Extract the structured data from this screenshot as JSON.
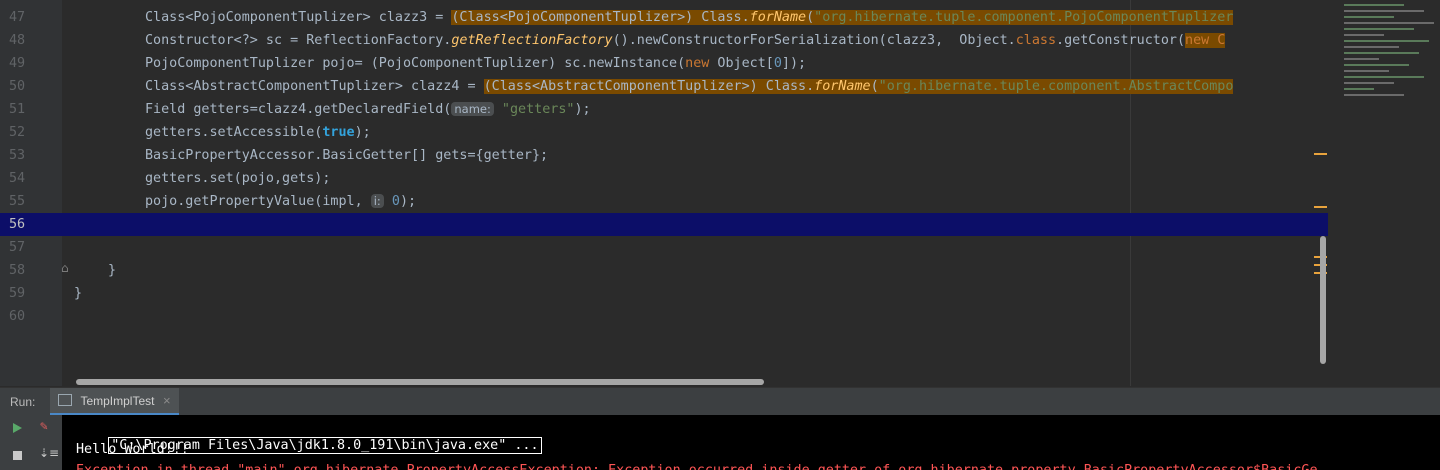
{
  "editor": {
    "lines": [
      {
        "num": "47",
        "segments": [
          {
            "t": "Class<PojoComponentTuplizer> clazz3 = ",
            "c": ""
          },
          {
            "t": "(Class<PojoComponentTuplizer>) Class.",
            "c": "hl"
          },
          {
            "t": "forName",
            "c": "hl it"
          },
          {
            "t": "(",
            "c": "hl"
          },
          {
            "t": "\"org.hibernate.tuple.component.PojoComponentTuplizer",
            "c": "hl str"
          }
        ]
      },
      {
        "num": "48",
        "segments": [
          {
            "t": "Constructor<?> sc = ReflectionFactory.",
            "c": ""
          },
          {
            "t": "getReflectionFactory",
            "c": "it"
          },
          {
            "t": "().newConstructorForSerialization(clazz3,  Object.",
            "c": ""
          },
          {
            "t": "class",
            "c": "kw"
          },
          {
            "t": ".getConstructor(",
            "c": ""
          },
          {
            "t": "new C",
            "c": "hl kw"
          }
        ]
      },
      {
        "num": "49",
        "segments": [
          {
            "t": "PojoComponentTuplizer pojo= (PojoComponentTuplizer) sc.newInstance(",
            "c": ""
          },
          {
            "t": "new",
            "c": "kw"
          },
          {
            "t": " Object[",
            "c": ""
          },
          {
            "t": "0",
            "c": "num"
          },
          {
            "t": "]);",
            "c": ""
          }
        ]
      },
      {
        "num": "50",
        "segments": [
          {
            "t": "Class<AbstractComponentTuplizer> clazz4 = ",
            "c": ""
          },
          {
            "t": "(Class<AbstractComponentTuplizer>) Class.",
            "c": "hl"
          },
          {
            "t": "forName",
            "c": "hl it"
          },
          {
            "t": "(",
            "c": "hl"
          },
          {
            "t": "\"org.hibernate.tuple.component.AbstractCompo",
            "c": "hl str"
          }
        ]
      },
      {
        "num": "51",
        "segments": [
          {
            "t": "Field getters=clazz4.getDeclaredField(",
            "c": ""
          },
          {
            "t": "name:",
            "c": "hint"
          },
          {
            "t": " ",
            "c": ""
          },
          {
            "t": "\"getters\"",
            "c": "str"
          },
          {
            "t": ");",
            "c": ""
          }
        ]
      },
      {
        "num": "52",
        "segments": [
          {
            "t": "getters.setAccessible(",
            "c": ""
          },
          {
            "t": "true",
            "c": "tru"
          },
          {
            "t": ");",
            "c": ""
          }
        ]
      },
      {
        "num": "53",
        "segments": [
          {
            "t": "BasicPropertyAccessor.BasicGetter[] gets={getter};",
            "c": ""
          }
        ]
      },
      {
        "num": "54",
        "segments": [
          {
            "t": "getters.set(pojo,gets);",
            "c": ""
          }
        ]
      },
      {
        "num": "55",
        "segments": [
          {
            "t": "pojo.getPropertyValue(impl, ",
            "c": ""
          },
          {
            "t": "i:",
            "c": "hint"
          },
          {
            "t": " ",
            "c": ""
          },
          {
            "t": "0",
            "c": "num"
          },
          {
            "t": ");",
            "c": ""
          }
        ]
      },
      {
        "num": "56",
        "segments": [],
        "current": true
      },
      {
        "num": "57",
        "segments": []
      },
      {
        "num": "58",
        "segments": [
          {
            "t": "}",
            "c": "",
            "indent": "inner"
          }
        ]
      },
      {
        "num": "59",
        "segments": [
          {
            "t": "}",
            "c": "",
            "indent": "outer"
          }
        ]
      },
      {
        "num": "60",
        "segments": []
      }
    ]
  },
  "run": {
    "label": "Run:",
    "tab_label": "TempImplTest",
    "tab_close": "×"
  },
  "console": {
    "command": "\"C:\\Program Files\\Java\\jdk1.8.0_191\\bin\\java.exe\" ...",
    "line2": "Hello World!!!",
    "line3": "Exception in thread \"main\" org.hibernate.PropertyAccessException: Exception occurred inside getter of org.hibernate.property.BasicPropertyAccessor$BasicGe"
  },
  "colors": {
    "accent": "#4a88c7",
    "highlight": "#7a4a00",
    "current_line": "#0c0e68",
    "error": "#ff5555"
  },
  "icons": [
    "run-icon",
    "edit-icon",
    "stop-icon",
    "sort-icon",
    "fold-icon",
    "console-tab-icon"
  ]
}
